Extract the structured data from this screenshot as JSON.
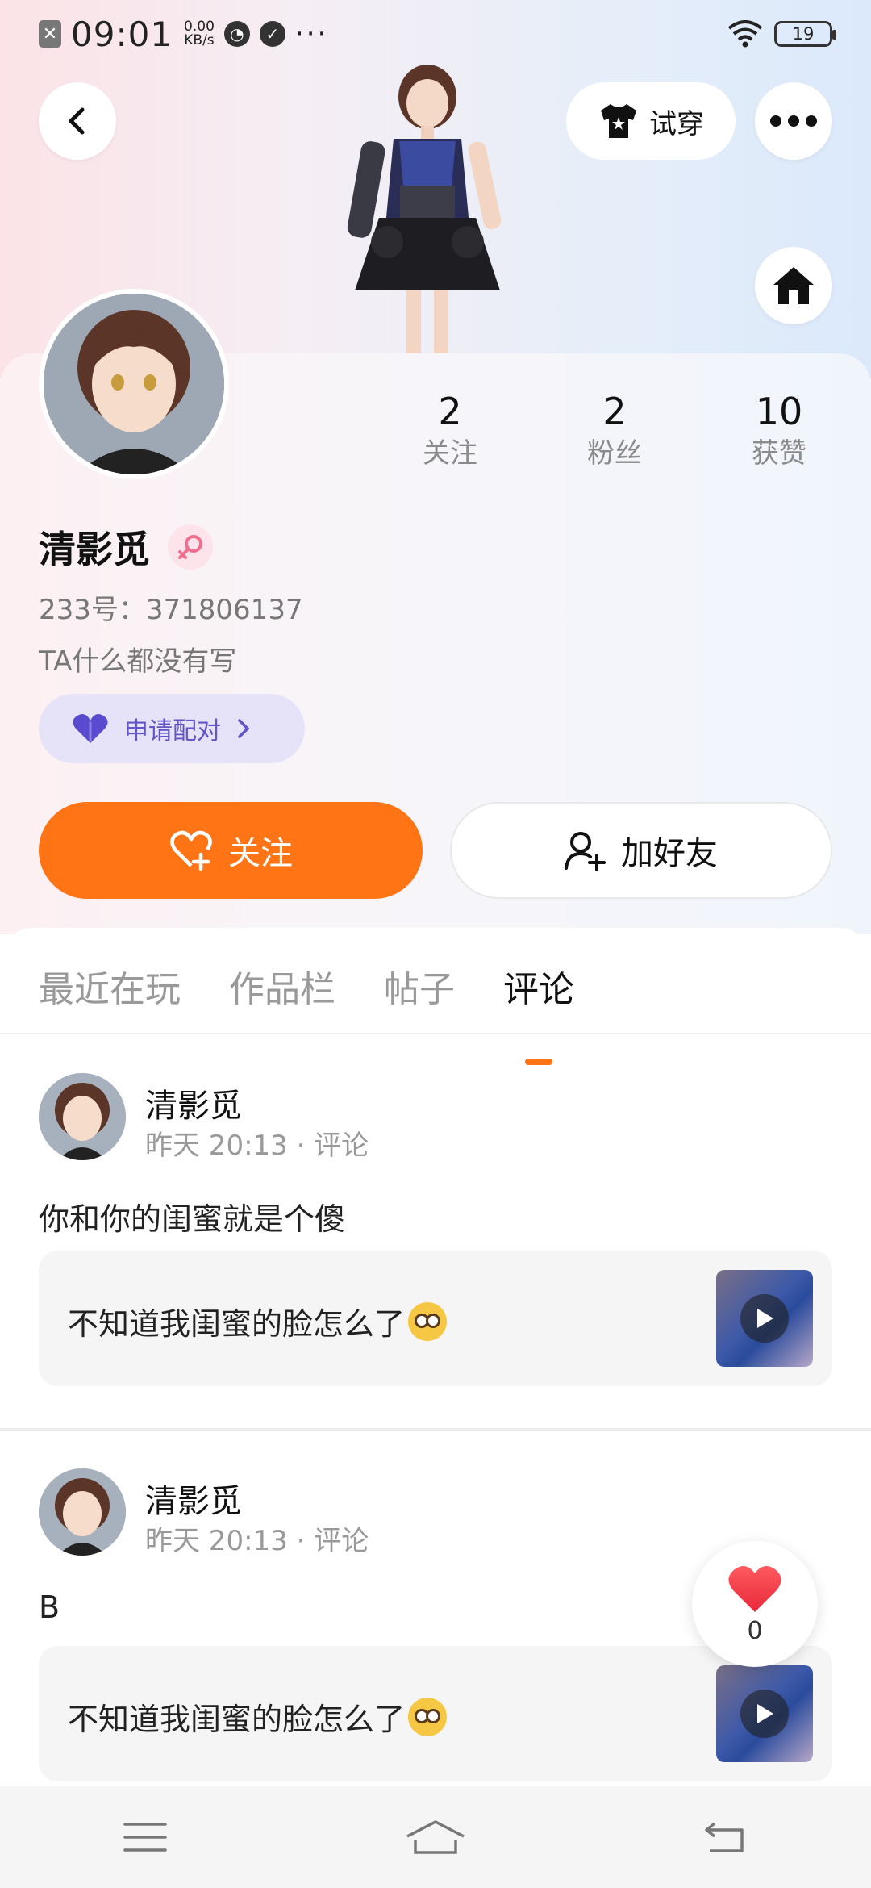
{
  "status_bar": {
    "time": "09:01",
    "speed_value": "0.00",
    "speed_unit": "KB/s",
    "battery": "19",
    "more": "···"
  },
  "header": {
    "tryon_label": "试穿"
  },
  "profile": {
    "name": "清影觅",
    "uid": "233号：371806137",
    "bio": "TA什么都没有写",
    "pair_label": "申请配对",
    "stats": [
      {
        "value": "2",
        "label": "关注"
      },
      {
        "value": "2",
        "label": "粉丝"
      },
      {
        "value": "10",
        "label": "获赞"
      }
    ],
    "follow_label": "关注",
    "add_friend_label": "加好友"
  },
  "tabs": [
    {
      "label": "最近在玩",
      "active": false
    },
    {
      "label": "作品栏",
      "active": false
    },
    {
      "label": "帖子",
      "active": false
    },
    {
      "label": "评论",
      "active": true
    }
  ],
  "posts": [
    {
      "author": "清影觅",
      "meta": "昨天 20:13 · 评论",
      "text": "你和你的闺蜜就是个傻",
      "quote": "不知道我闺蜜的脸怎么了"
    },
    {
      "author": "清影觅",
      "meta": "昨天 20:13 · 评论",
      "text": "B",
      "quote": "不知道我闺蜜的脸怎么了"
    }
  ],
  "like_fab": {
    "count": "0"
  },
  "colors": {
    "accent": "#ff7415",
    "pair": "#6255c9"
  }
}
